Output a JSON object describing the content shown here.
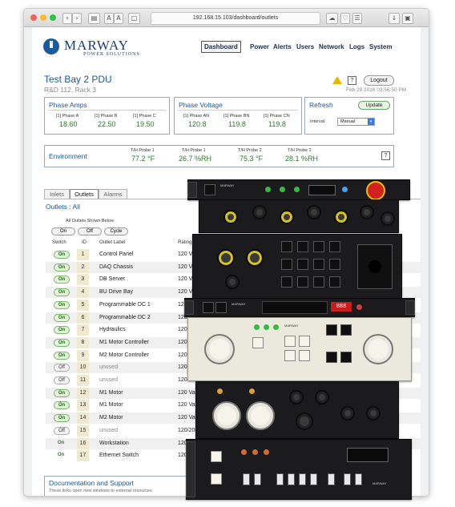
{
  "browser": {
    "url": "192.168.15.103/dashboard/outlets",
    "font_small": "A",
    "font_large": "A"
  },
  "brand": {
    "name": "MARWAY",
    "tagline": "POWER SOLUTIONS",
    "color": "#1c5aa0"
  },
  "nav": [
    "Dashboard",
    "Power",
    "Alerts",
    "Users",
    "Network",
    "Logs",
    "System"
  ],
  "header": {
    "title": "Test Bay 2 PDU",
    "subtitle": "R&D 112, Rack 3",
    "help": "?",
    "logout": "Logout",
    "datetime": "Feb 29 2016 03:56:50 PM"
  },
  "phase_amps": {
    "title": "Phase Amps",
    "items": [
      {
        "label": "[1] Phase A",
        "value": "18.60"
      },
      {
        "label": "[1] Phase B",
        "value": "22.50"
      },
      {
        "label": "[1] Phase C",
        "value": "19.50"
      }
    ]
  },
  "phase_voltage": {
    "title": "Phase Voltage",
    "items": [
      {
        "label": "[1] Phase AN",
        "value": "120.8"
      },
      {
        "label": "[1] Phase BN",
        "value": "119.8"
      },
      {
        "label": "[1] Phase CN",
        "value": "119.8"
      }
    ]
  },
  "refresh": {
    "title": "Refresh",
    "update": "Update",
    "interval_label": "Interval:",
    "interval_value": "Manual"
  },
  "environment": {
    "title": "Environment",
    "items": [
      {
        "label": "T/H Probe 1",
        "value": "77.2 °F"
      },
      {
        "label": "T/H Probe 1",
        "value": "26.7 %RH"
      },
      {
        "label": "T/H Probe 2",
        "value": "75.3 °F"
      },
      {
        "label": "T/H Probe 2",
        "value": "28.1 %RH"
      }
    ]
  },
  "tabs": [
    "Inlets",
    "Outlets",
    "Alarms"
  ],
  "outlets": {
    "title": "Outlets : All",
    "shown": "All Outlets Shown Below",
    "controls": [
      "On",
      "Off",
      "Cycle"
    ],
    "headers": {
      "switch": "Switch",
      "id": "ID",
      "label": "Outlet Label",
      "rating": "Rating"
    },
    "rows": [
      {
        "switch": "On",
        "id": "1",
        "label": "Control Panel",
        "rating": "120 Vac"
      },
      {
        "switch": "On",
        "id": "2",
        "label": "DAQ Chassis",
        "rating": "120 Vac"
      },
      {
        "switch": "On",
        "id": "3",
        "label": "DB Server",
        "rating": "120 Vac"
      },
      {
        "switch": "On",
        "id": "4",
        "label": "BU Drive Bay",
        "rating": "120 Vac"
      },
      {
        "switch": "On",
        "id": "5",
        "label": "Programmable DC 1",
        "rating": "120 Vac"
      },
      {
        "switch": "On",
        "id": "6",
        "label": "Programmable DC 2",
        "rating": "120 Vac"
      },
      {
        "switch": "On",
        "id": "7",
        "label": "Hydraulics",
        "rating": "120 Vac"
      },
      {
        "switch": "On",
        "id": "8",
        "label": "M1 Motor Controller",
        "rating": "120 Vac"
      },
      {
        "switch": "On",
        "id": "9",
        "label": "M2 Motor Controller",
        "rating": "120 Vac"
      },
      {
        "switch": "Off",
        "id": "10",
        "label": "unused",
        "rating": "120 Vac"
      },
      {
        "switch": "Off",
        "id": "11",
        "label": "unused",
        "rating": "120 Vac"
      },
      {
        "switch": "On",
        "id": "12",
        "label": "M1 Motor",
        "rating": "120 Vac"
      },
      {
        "switch": "On",
        "id": "13",
        "label": "M1 Motor",
        "rating": "120 Vac"
      },
      {
        "switch": "On",
        "id": "14",
        "label": "M2 Motor",
        "rating": "120 Vac"
      },
      {
        "switch": "Off",
        "id": "15",
        "label": "unused",
        "rating": "120/208"
      },
      {
        "switch": "On",
        "id": "16",
        "label": "Workstation",
        "rating": "120/208"
      },
      {
        "switch": "On",
        "id": "17",
        "label": "Ethernet Switch",
        "rating": "120/208"
      }
    ]
  },
  "documentation": {
    "title": "Documentation and Support",
    "subtitle": "These links open new windows to external resources."
  },
  "hardware": {
    "brand_mark": "MARWAY"
  }
}
